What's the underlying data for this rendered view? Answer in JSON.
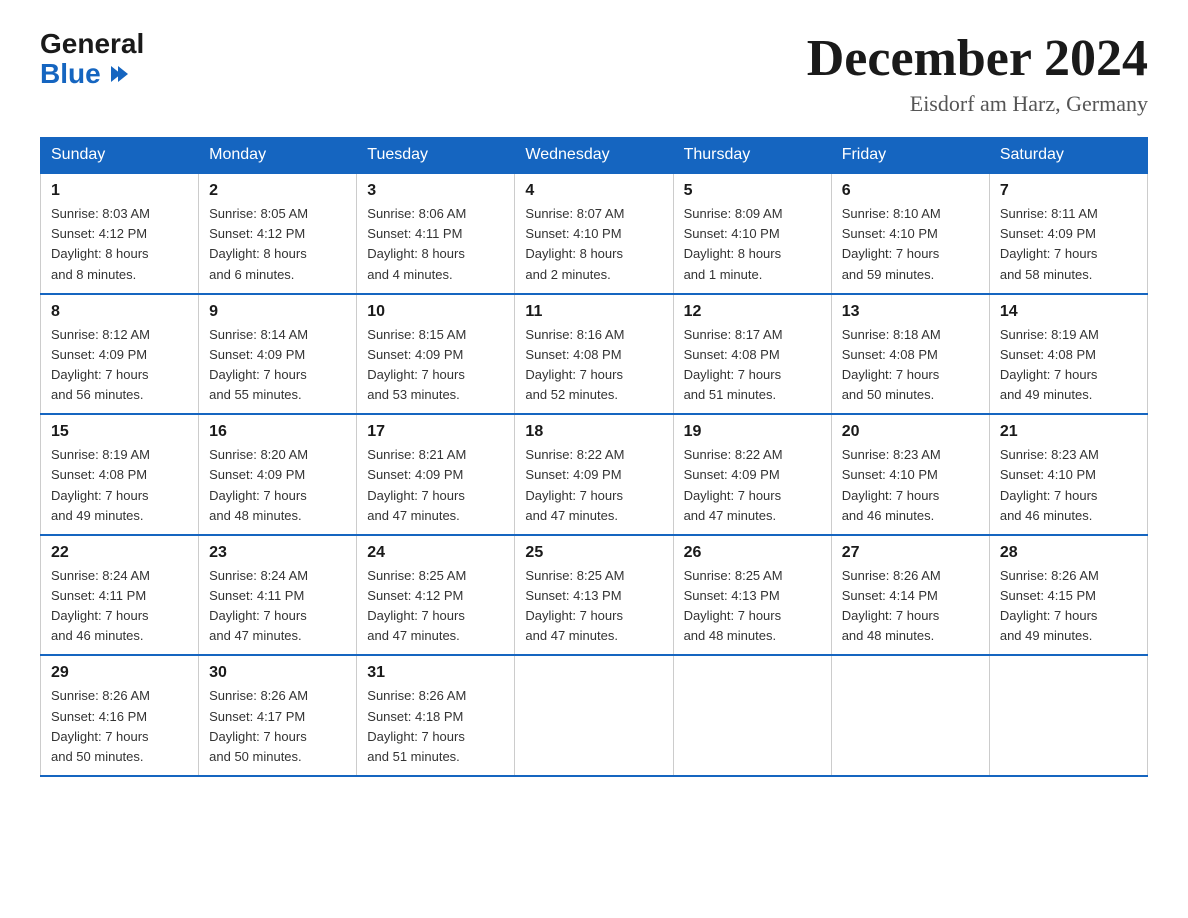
{
  "logo": {
    "general": "General",
    "blue": "Blue"
  },
  "title": "December 2024",
  "subtitle": "Eisdorf am Harz, Germany",
  "days_of_week": [
    "Sunday",
    "Monday",
    "Tuesday",
    "Wednesday",
    "Thursday",
    "Friday",
    "Saturday"
  ],
  "weeks": [
    [
      {
        "day": "1",
        "info": "Sunrise: 8:03 AM\nSunset: 4:12 PM\nDaylight: 8 hours\nand 8 minutes."
      },
      {
        "day": "2",
        "info": "Sunrise: 8:05 AM\nSunset: 4:12 PM\nDaylight: 8 hours\nand 6 minutes."
      },
      {
        "day": "3",
        "info": "Sunrise: 8:06 AM\nSunset: 4:11 PM\nDaylight: 8 hours\nand 4 minutes."
      },
      {
        "day": "4",
        "info": "Sunrise: 8:07 AM\nSunset: 4:10 PM\nDaylight: 8 hours\nand 2 minutes."
      },
      {
        "day": "5",
        "info": "Sunrise: 8:09 AM\nSunset: 4:10 PM\nDaylight: 8 hours\nand 1 minute."
      },
      {
        "day": "6",
        "info": "Sunrise: 8:10 AM\nSunset: 4:10 PM\nDaylight: 7 hours\nand 59 minutes."
      },
      {
        "day": "7",
        "info": "Sunrise: 8:11 AM\nSunset: 4:09 PM\nDaylight: 7 hours\nand 58 minutes."
      }
    ],
    [
      {
        "day": "8",
        "info": "Sunrise: 8:12 AM\nSunset: 4:09 PM\nDaylight: 7 hours\nand 56 minutes."
      },
      {
        "day": "9",
        "info": "Sunrise: 8:14 AM\nSunset: 4:09 PM\nDaylight: 7 hours\nand 55 minutes."
      },
      {
        "day": "10",
        "info": "Sunrise: 8:15 AM\nSunset: 4:09 PM\nDaylight: 7 hours\nand 53 minutes."
      },
      {
        "day": "11",
        "info": "Sunrise: 8:16 AM\nSunset: 4:08 PM\nDaylight: 7 hours\nand 52 minutes."
      },
      {
        "day": "12",
        "info": "Sunrise: 8:17 AM\nSunset: 4:08 PM\nDaylight: 7 hours\nand 51 minutes."
      },
      {
        "day": "13",
        "info": "Sunrise: 8:18 AM\nSunset: 4:08 PM\nDaylight: 7 hours\nand 50 minutes."
      },
      {
        "day": "14",
        "info": "Sunrise: 8:19 AM\nSunset: 4:08 PM\nDaylight: 7 hours\nand 49 minutes."
      }
    ],
    [
      {
        "day": "15",
        "info": "Sunrise: 8:19 AM\nSunset: 4:08 PM\nDaylight: 7 hours\nand 49 minutes."
      },
      {
        "day": "16",
        "info": "Sunrise: 8:20 AM\nSunset: 4:09 PM\nDaylight: 7 hours\nand 48 minutes."
      },
      {
        "day": "17",
        "info": "Sunrise: 8:21 AM\nSunset: 4:09 PM\nDaylight: 7 hours\nand 47 minutes."
      },
      {
        "day": "18",
        "info": "Sunrise: 8:22 AM\nSunset: 4:09 PM\nDaylight: 7 hours\nand 47 minutes."
      },
      {
        "day": "19",
        "info": "Sunrise: 8:22 AM\nSunset: 4:09 PM\nDaylight: 7 hours\nand 47 minutes."
      },
      {
        "day": "20",
        "info": "Sunrise: 8:23 AM\nSunset: 4:10 PM\nDaylight: 7 hours\nand 46 minutes."
      },
      {
        "day": "21",
        "info": "Sunrise: 8:23 AM\nSunset: 4:10 PM\nDaylight: 7 hours\nand 46 minutes."
      }
    ],
    [
      {
        "day": "22",
        "info": "Sunrise: 8:24 AM\nSunset: 4:11 PM\nDaylight: 7 hours\nand 46 minutes."
      },
      {
        "day": "23",
        "info": "Sunrise: 8:24 AM\nSunset: 4:11 PM\nDaylight: 7 hours\nand 47 minutes."
      },
      {
        "day": "24",
        "info": "Sunrise: 8:25 AM\nSunset: 4:12 PM\nDaylight: 7 hours\nand 47 minutes."
      },
      {
        "day": "25",
        "info": "Sunrise: 8:25 AM\nSunset: 4:13 PM\nDaylight: 7 hours\nand 47 minutes."
      },
      {
        "day": "26",
        "info": "Sunrise: 8:25 AM\nSunset: 4:13 PM\nDaylight: 7 hours\nand 48 minutes."
      },
      {
        "day": "27",
        "info": "Sunrise: 8:26 AM\nSunset: 4:14 PM\nDaylight: 7 hours\nand 48 minutes."
      },
      {
        "day": "28",
        "info": "Sunrise: 8:26 AM\nSunset: 4:15 PM\nDaylight: 7 hours\nand 49 minutes."
      }
    ],
    [
      {
        "day": "29",
        "info": "Sunrise: 8:26 AM\nSunset: 4:16 PM\nDaylight: 7 hours\nand 50 minutes."
      },
      {
        "day": "30",
        "info": "Sunrise: 8:26 AM\nSunset: 4:17 PM\nDaylight: 7 hours\nand 50 minutes."
      },
      {
        "day": "31",
        "info": "Sunrise: 8:26 AM\nSunset: 4:18 PM\nDaylight: 7 hours\nand 51 minutes."
      },
      {
        "day": "",
        "info": ""
      },
      {
        "day": "",
        "info": ""
      },
      {
        "day": "",
        "info": ""
      },
      {
        "day": "",
        "info": ""
      }
    ]
  ]
}
